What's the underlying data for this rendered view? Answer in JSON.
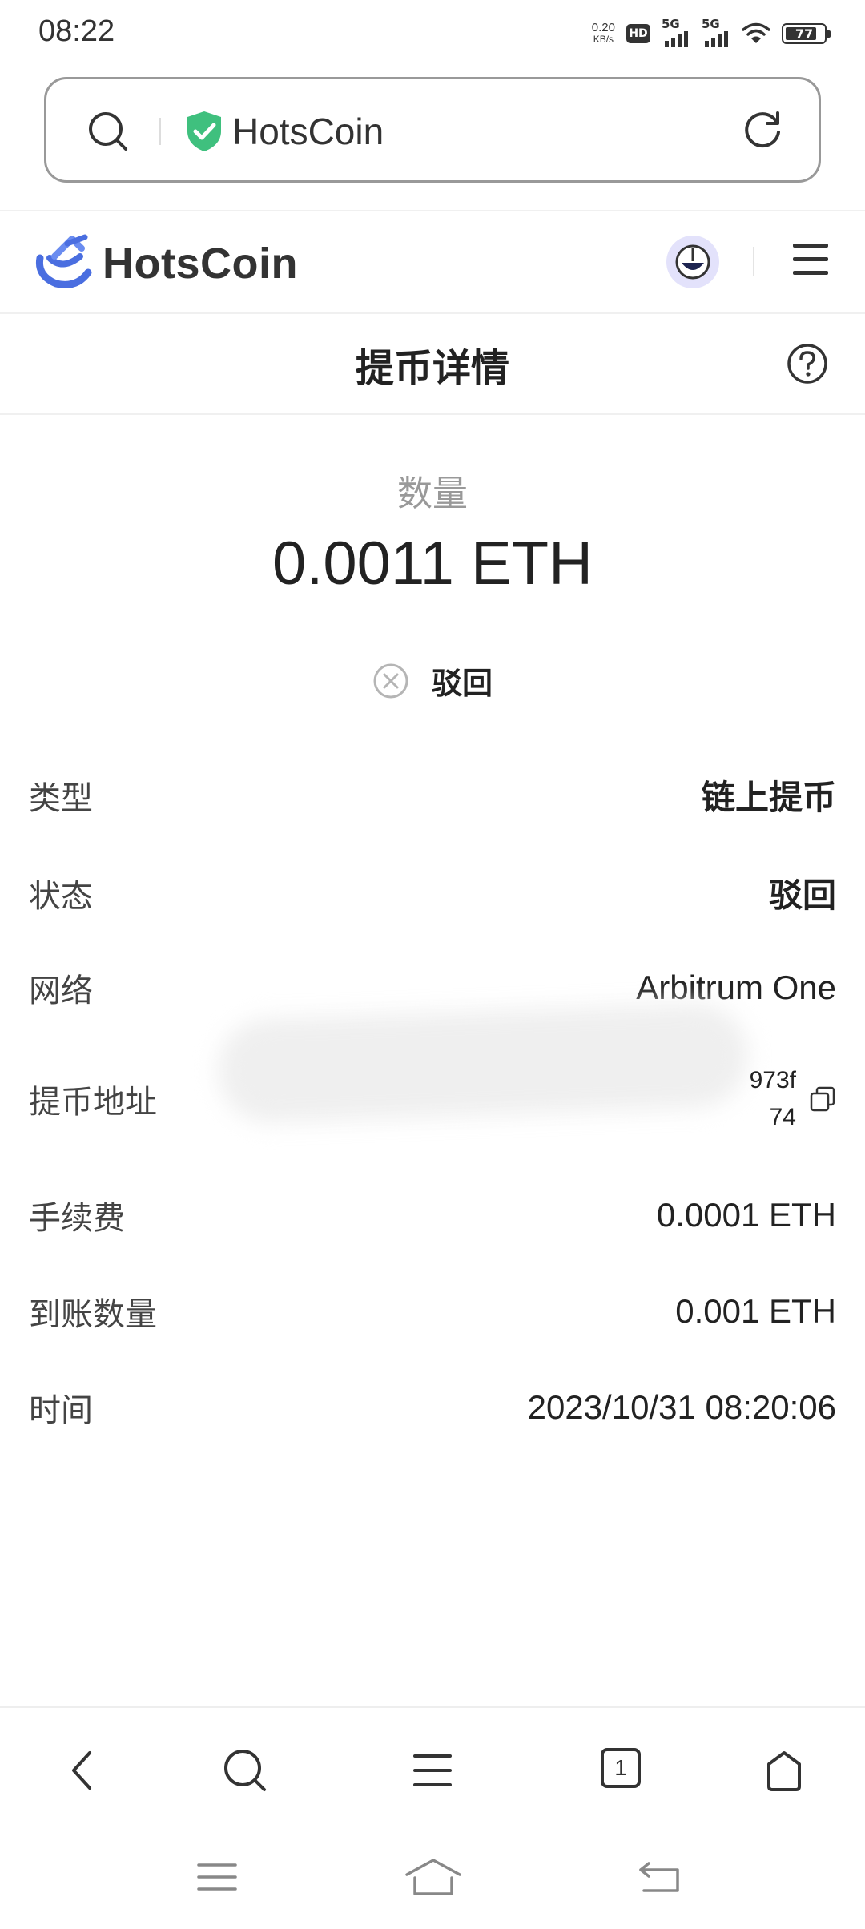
{
  "status_bar": {
    "time": "08:22",
    "net_speed_value": "0.20",
    "net_speed_unit": "KB/s",
    "hd_label": "HD",
    "sim1_label": "5G",
    "sim2_label": "5G",
    "battery": "77"
  },
  "browser": {
    "url_text": "HotsCoin",
    "toolbar": {
      "back_icon": "chevron-left-icon",
      "search_icon": "search-icon",
      "menu_icon": "menu-icon",
      "tab_count": "1",
      "home_icon": "home-icon"
    }
  },
  "site": {
    "brand": "HotsCoin",
    "accent_color": "#4a6ee0"
  },
  "page": {
    "title": "提币详情",
    "amount_label": "数量",
    "amount_value": "0.0011 ETH",
    "status_text": "驳回",
    "details": {
      "type": {
        "label": "类型",
        "value": "链上提币"
      },
      "status": {
        "label": "状态",
        "value": "驳回"
      },
      "network": {
        "label": "网络",
        "value": "Arbitrum One"
      },
      "address": {
        "label": "提币地址",
        "value_line1": "973f",
        "value_line2": "74"
      },
      "fee": {
        "label": "手续费",
        "value": "0.0001 ETH"
      },
      "received": {
        "label": "到账数量",
        "value": "0.001 ETH"
      },
      "time": {
        "label": "时间",
        "value": "2023/10/31 08:20:06"
      }
    }
  }
}
